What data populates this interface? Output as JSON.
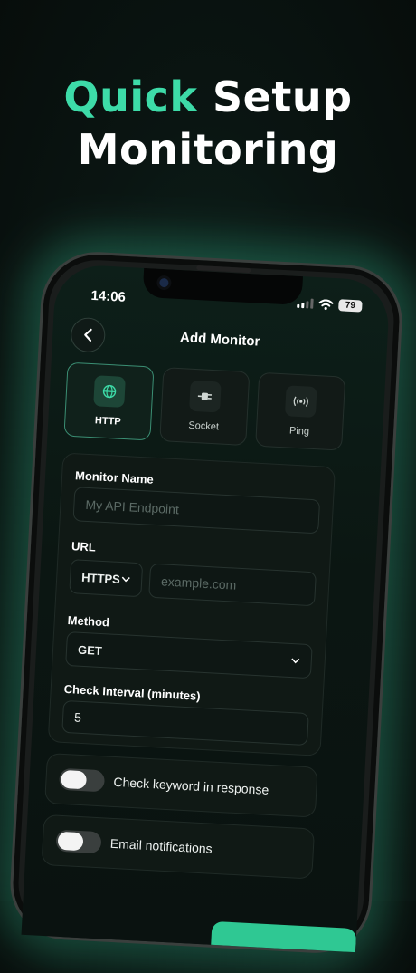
{
  "headline": {
    "accent": "Quick",
    "rest": " Setup",
    "line2": "Monitoring"
  },
  "status": {
    "time": "14:06",
    "battery": "79"
  },
  "nav": {
    "title": "Add Monitor"
  },
  "types": [
    {
      "label": "HTTP",
      "icon": "globe-icon",
      "selected": true
    },
    {
      "label": "Socket",
      "icon": "plug-icon",
      "selected": false
    },
    {
      "label": "Ping",
      "icon": "broadcast-icon",
      "selected": false
    }
  ],
  "form": {
    "monitor_name_label": "Monitor Name",
    "monitor_name_placeholder": "My API Endpoint",
    "url_label": "URL",
    "protocol": "HTTPS",
    "url_placeholder": "example.com",
    "method_label": "Method",
    "method": "GET",
    "interval_label": "Check Interval (minutes)",
    "interval": "5"
  },
  "toggles": {
    "keyword": "Check keyword in response",
    "email": "Email notifications"
  },
  "colors": {
    "accent": "#3ddba8",
    "selected_border": "#3b8f74"
  }
}
